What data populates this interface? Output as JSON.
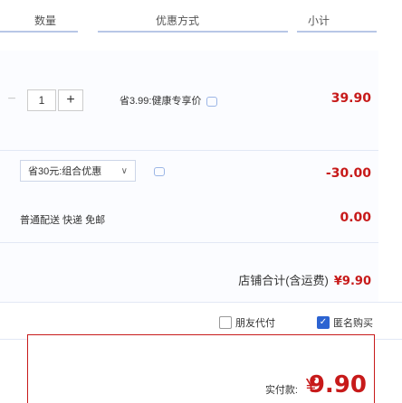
{
  "header": {
    "col_qty": "数量",
    "col_promo": "优惠方式",
    "col_subtotal": "小计"
  },
  "item": {
    "qty_minus": "−",
    "qty_value": "1",
    "qty_plus": "+",
    "promo_text": "省3.99:健康专享价",
    "price": "39.90"
  },
  "coupon": {
    "label": "省30元:组合优惠",
    "chevron": "∨",
    "discount": "-30.00"
  },
  "shipping": {
    "label": "普通配送 快递 免邮",
    "fee": "0.00"
  },
  "store_total": {
    "label": "店铺合计(含运费)",
    "amount": "¥9.90"
  },
  "options": {
    "friend_pay": "朋友代付",
    "anonymous": "匿名购买",
    "anonymous_checked": true
  },
  "payment": {
    "label": "实付款:",
    "currency": "¥",
    "amount": "9.90"
  },
  "colors": {
    "accent_red": "#c71a1a",
    "accent_blue": "#2c63d1"
  }
}
